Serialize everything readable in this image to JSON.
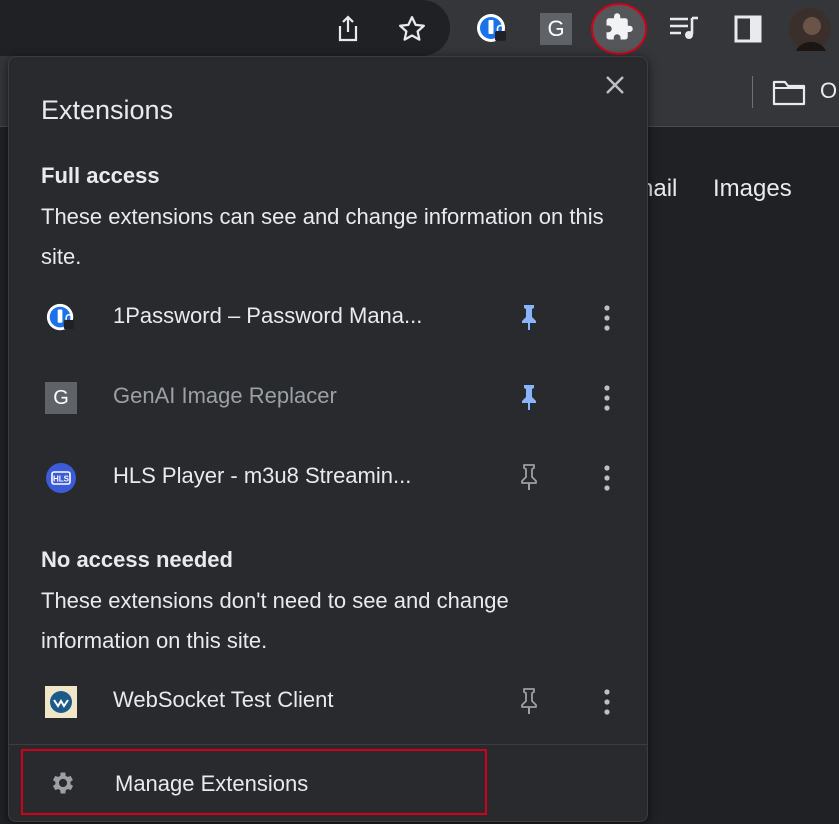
{
  "toolbar": {
    "icons": [
      "share-icon",
      "star-icon",
      "1password-icon",
      "genai-icon",
      "puzzle-icon",
      "media-queue-icon",
      "side-panel-icon",
      "avatar"
    ],
    "genai_letter": "G",
    "highlight_color": "#d0021b"
  },
  "bookmarks": {
    "folder_label": "O"
  },
  "page": {
    "links": [
      "nail",
      "Images"
    ]
  },
  "popup": {
    "title": "Extensions",
    "full_access": {
      "heading": "Full access",
      "description": "These extensions can see and change information on this site.",
      "items": [
        {
          "name": "1Password – Password Mana...",
          "icon": "1password-icon",
          "pinned": true,
          "dimmed": false
        },
        {
          "name": "GenAI Image Replacer",
          "icon": "genai-icon",
          "pinned": true,
          "dimmed": true
        },
        {
          "name": "HLS Player - m3u8 Streamin...",
          "icon": "hls-icon",
          "pinned": false,
          "dimmed": false
        }
      ]
    },
    "no_access": {
      "heading": "No access needed",
      "description": "These extensions don't need to see and change information on this site.",
      "items": [
        {
          "name": "WebSocket Test Client",
          "icon": "websocket-icon",
          "pinned": false,
          "dimmed": false
        }
      ]
    },
    "hls_icon_text": "HLS",
    "manage_label": "Manage Extensions",
    "pinned_color": "#8ab4f8",
    "unpinned_color": "#9aa0a6"
  }
}
